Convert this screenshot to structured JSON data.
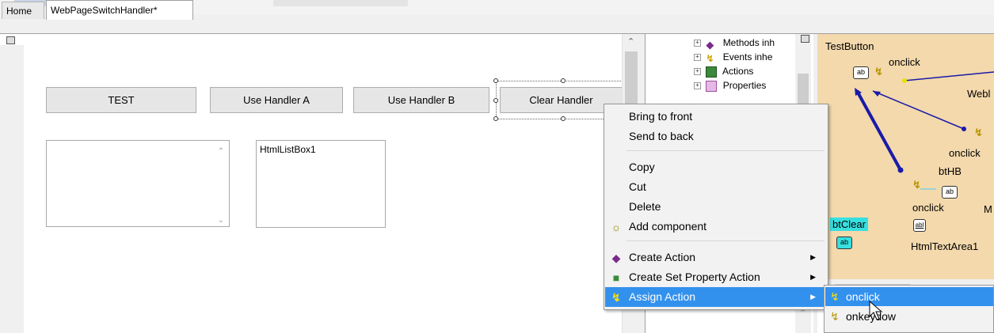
{
  "tabs": {
    "home": "Home",
    "active": "WebPageSwitchHandler*"
  },
  "designer": {
    "buttons": {
      "test": "TEST",
      "use_handler_a": "Use Handler A",
      "use_handler_b": "Use Handler B",
      "clear_handler": "Clear Handler"
    },
    "listbox_label": "HtmlListBox1"
  },
  "tree": {
    "items": [
      "Methods inh",
      "Events inhe",
      "Actions",
      "Properties"
    ]
  },
  "diagram": {
    "test_button": "TestButton",
    "onclick_1": "onclick",
    "webl": "Webl",
    "onclick_2": "onclick",
    "bthb": "btHB",
    "onclick_3": "onclick",
    "m": "M",
    "btclear": "btClear",
    "htmltextarea": "HtmlTextArea1",
    "ab": "ab",
    "abl": "abl"
  },
  "context_menu": {
    "bring_to_front": "Bring to front",
    "send_to_back": "Send to back",
    "copy": "Copy",
    "cut": "Cut",
    "delete": "Delete",
    "add_component": "Add component",
    "create_action": "Create Action",
    "create_set_property_action": "Create Set Property Action",
    "assign_action": "Assign Action"
  },
  "submenu": {
    "onclick": "onclick",
    "onkeydown": "onkeydow"
  },
  "colors": {
    "highlight": "#3391ee",
    "diagram_bg": "#f3d9ac",
    "btclear_bg": "#37e0e0",
    "arrow": "#1a1aa8"
  }
}
